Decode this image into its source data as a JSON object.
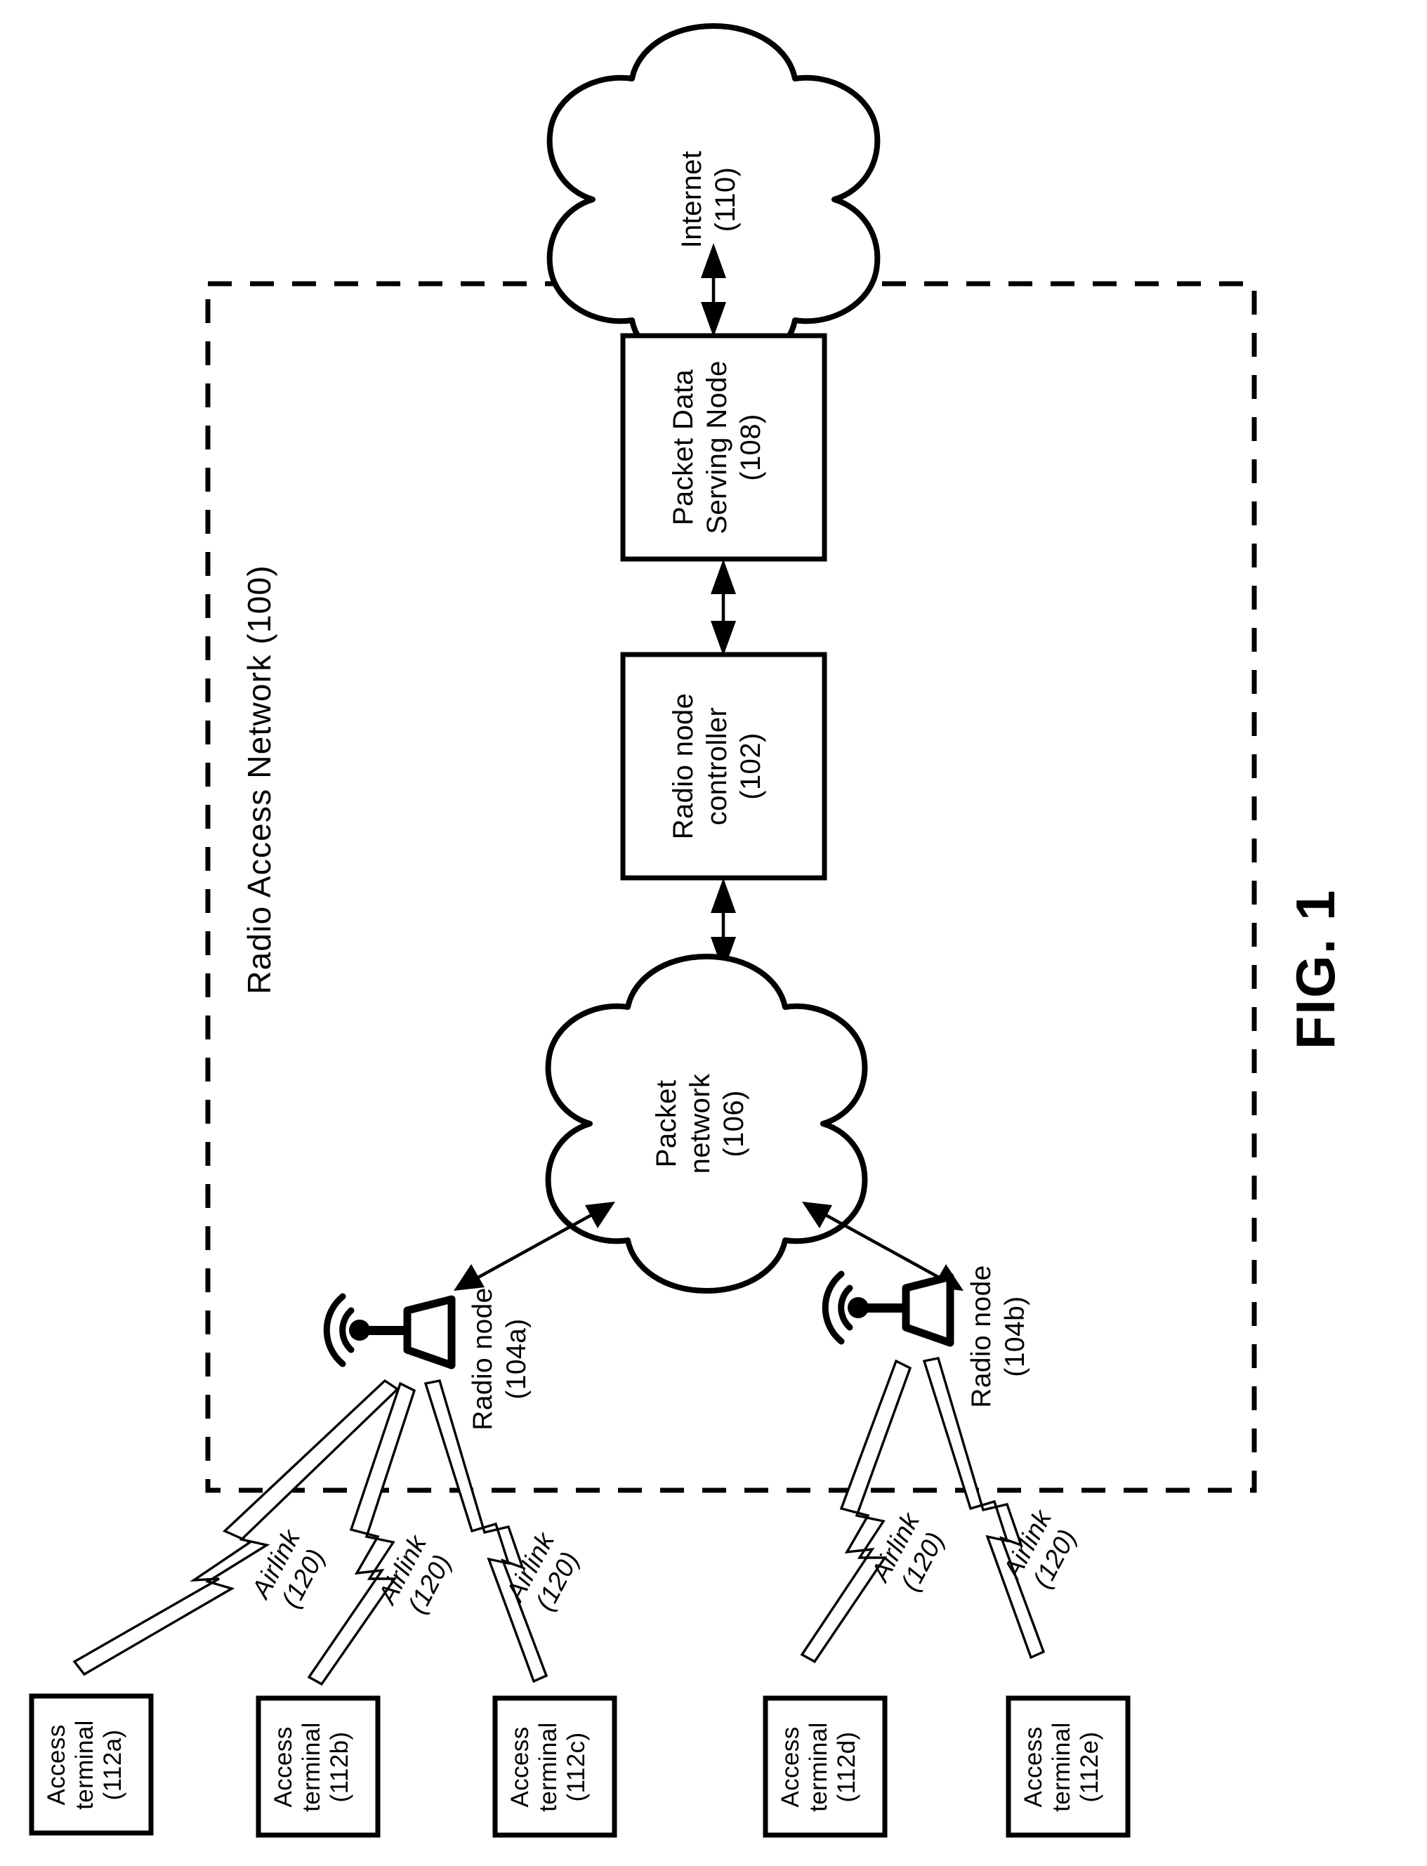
{
  "figure": {
    "caption": "FIG. 1",
    "boundary_label": "Radio Access Network (100)"
  },
  "clouds": [
    {
      "id": "internet",
      "line1": "Internet",
      "line2": "(110)"
    },
    {
      "id": "packet-network",
      "line1": "Packet",
      "line2": "network",
      "line3": "(106)"
    }
  ],
  "boxes": [
    {
      "id": "packet-data-serving-node",
      "line1": "Packet Data",
      "line2": "Serving Node",
      "line3": "(108)"
    },
    {
      "id": "radio-node-controller",
      "line1": "Radio node",
      "line2": "controller",
      "line3": "(102)"
    }
  ],
  "radio_nodes": [
    {
      "id": "radio-node-104a",
      "line1": "Radio node",
      "line2": "(104a)"
    },
    {
      "id": "radio-node-104b",
      "line1": "Radio node",
      "line2": "(104b)"
    }
  ],
  "access_terminals": [
    {
      "id": "access-terminal-112a",
      "line1": "Access",
      "line2": "terminal",
      "line3": "(112a)"
    },
    {
      "id": "access-terminal-112b",
      "line1": "Access",
      "line2": "terminal",
      "line3": "(112b)"
    },
    {
      "id": "access-terminal-112c",
      "line1": "Access",
      "line2": "terminal",
      "line3": "(112c)"
    },
    {
      "id": "access-terminal-112d",
      "line1": "Access",
      "line2": "terminal",
      "line3": "(112d)"
    },
    {
      "id": "access-terminal-112e",
      "line1": "Access",
      "line2": "terminal",
      "line3": "(112e)"
    }
  ],
  "airlinks": [
    {
      "id": "airlink-112a",
      "line1": "Airlink",
      "line2": "(120)"
    },
    {
      "id": "airlink-112b",
      "line1": "Airlink",
      "line2": "(120)"
    },
    {
      "id": "airlink-112c",
      "line1": "Airlink",
      "line2": "(120)"
    },
    {
      "id": "airlink-112d",
      "line1": "Airlink",
      "line2": "(120)"
    },
    {
      "id": "airlink-112e",
      "line1": "Airlink",
      "line2": "(120)"
    }
  ],
  "colors": {
    "ink": "#000000",
    "paper": "#ffffff"
  }
}
